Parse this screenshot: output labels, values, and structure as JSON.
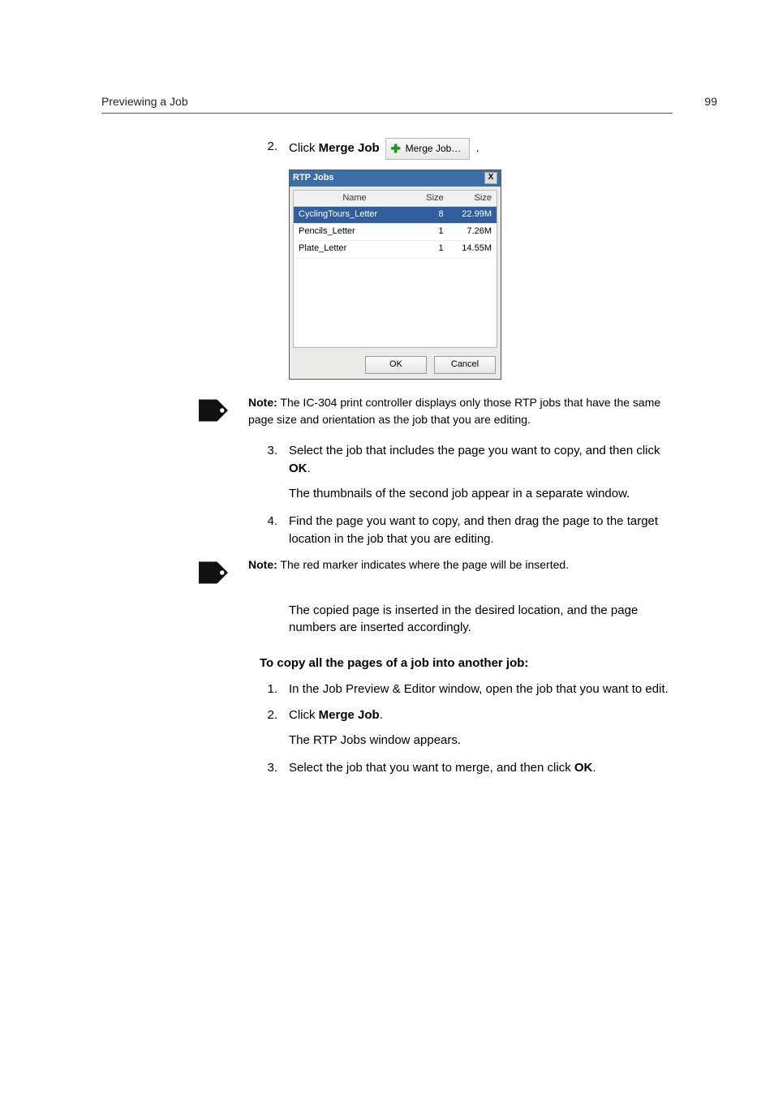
{
  "header": {
    "title": "Previewing a Job",
    "page_number": "99"
  },
  "section1": {
    "step2": {
      "num": "2.",
      "text_a": "Click ",
      "bold_a": "Merge Job",
      "text_b": " ."
    },
    "merge_button": {
      "label": "Merge Job…"
    },
    "dialog": {
      "title": "RTP Jobs",
      "close": "X",
      "headers": {
        "name": "Name",
        "size1": "Size",
        "size2": "Size"
      },
      "rows": [
        {
          "name": "CyclingTours_Letter",
          "c1": "8",
          "c2": "22.99M",
          "selected": true
        },
        {
          "name": "Pencils_Letter",
          "c1": "1",
          "c2": "7.26M",
          "selected": false
        },
        {
          "name": "Plate_Letter",
          "c1": "1",
          "c2": "14.55M",
          "selected": false
        }
      ],
      "ok": "OK",
      "cancel": "Cancel"
    },
    "note1": {
      "label": "Note:",
      "text": "The IC-304 print controller displays only those RTP jobs that have the same page size and orientation as the job that you are editing."
    },
    "step3": {
      "num": "3.",
      "text_a": "Select the job that includes the page you want to copy, and then click ",
      "bold_a": "OK",
      "text_b": "."
    },
    "step3_follow": "The thumbnails of the second job appear in a separate window.",
    "step4": {
      "num": "4.",
      "text": "Find the page you want to copy, and then drag the page to the target location in the job that you are editing."
    },
    "note2": {
      "label": "Note:",
      "text": "The red marker indicates where the page will be inserted."
    },
    "step4_follow": "The copied page is inserted in the desired location, and the page numbers are inserted accordingly."
  },
  "section2": {
    "heading": "To copy all the pages of a job into another job:",
    "step1": {
      "num": "1.",
      "text": "In the Job Preview & Editor window, open the job that you want to edit."
    },
    "step2": {
      "num": "2.",
      "text_a": "Click ",
      "bold_a": "Merge Job",
      "text_b": "."
    },
    "step2_follow": "The RTP Jobs window appears.",
    "step3": {
      "num": "3.",
      "text_a": "Select the job that you want to merge, and then click ",
      "bold_a": "OK",
      "text_b": "."
    }
  }
}
